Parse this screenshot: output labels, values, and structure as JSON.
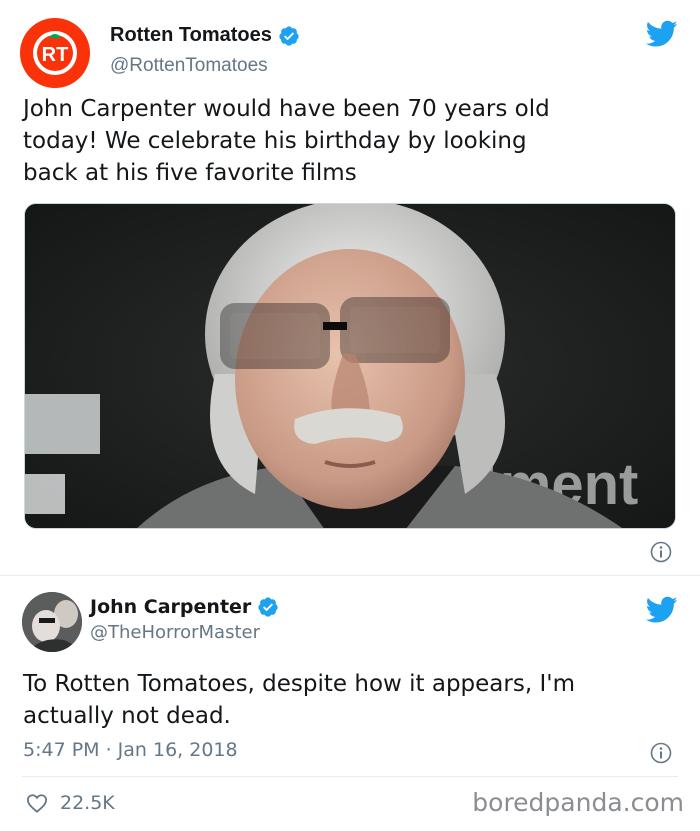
{
  "tweet1": {
    "display_name": "Rotten Tomatoes",
    "handle": "@RottenTomatoes",
    "avatar_text": "RT",
    "text_lines": [
      "John Carpenter would have been 70 years old",
      "today! We celebrate his birthday by looking",
      "back at his five favorite films"
    ],
    "media": "photo-of-john-carpenter",
    "info_icon": "info-icon",
    "brand_icon": "twitter-bird-icon"
  },
  "tweet2": {
    "display_name": "John Carpenter",
    "handle": "@TheHorrorMaster",
    "text_lines": [
      "To Rotten Tomatoes, despite how it appears, I'm",
      "actually not dead."
    ],
    "timestamp": "5:47 PM · Jan 16, 2018",
    "likes": "22.5K",
    "info_icon": "info-icon",
    "brand_icon": "twitter-bird-icon"
  },
  "watermark": "boredpanda.com",
  "colors": {
    "twitter_blue": "#1da1f2",
    "rt_red": "#fa320a",
    "secondary_text": "#657786",
    "divider": "#e6ecf0"
  }
}
